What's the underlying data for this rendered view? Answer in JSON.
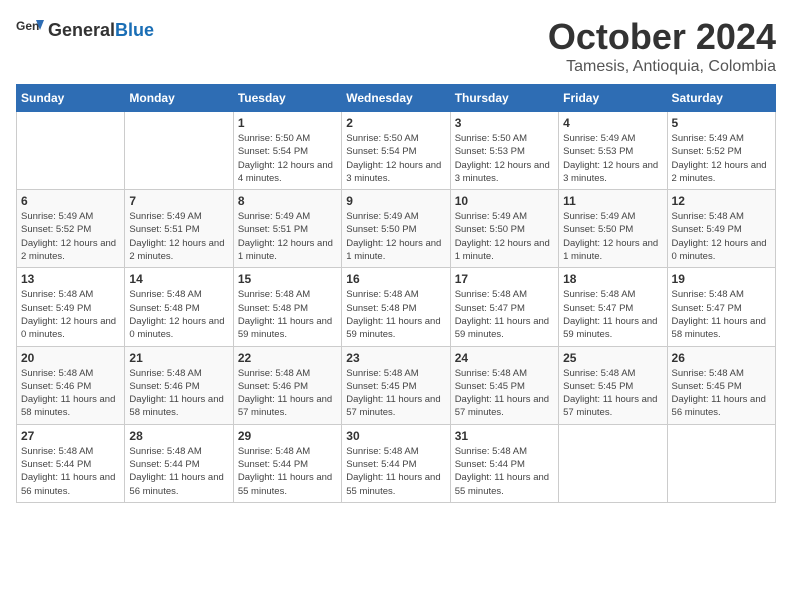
{
  "logo": {
    "general": "General",
    "blue": "Blue"
  },
  "title": {
    "month": "October 2024",
    "location": "Tamesis, Antioquia, Colombia"
  },
  "headers": [
    "Sunday",
    "Monday",
    "Tuesday",
    "Wednesday",
    "Thursday",
    "Friday",
    "Saturday"
  ],
  "weeks": [
    [
      {
        "day": "",
        "info": ""
      },
      {
        "day": "",
        "info": ""
      },
      {
        "day": "1",
        "info": "Sunrise: 5:50 AM\nSunset: 5:54 PM\nDaylight: 12 hours and 4 minutes."
      },
      {
        "day": "2",
        "info": "Sunrise: 5:50 AM\nSunset: 5:54 PM\nDaylight: 12 hours and 3 minutes."
      },
      {
        "day": "3",
        "info": "Sunrise: 5:50 AM\nSunset: 5:53 PM\nDaylight: 12 hours and 3 minutes."
      },
      {
        "day": "4",
        "info": "Sunrise: 5:49 AM\nSunset: 5:53 PM\nDaylight: 12 hours and 3 minutes."
      },
      {
        "day": "5",
        "info": "Sunrise: 5:49 AM\nSunset: 5:52 PM\nDaylight: 12 hours and 2 minutes."
      }
    ],
    [
      {
        "day": "6",
        "info": "Sunrise: 5:49 AM\nSunset: 5:52 PM\nDaylight: 12 hours and 2 minutes."
      },
      {
        "day": "7",
        "info": "Sunrise: 5:49 AM\nSunset: 5:51 PM\nDaylight: 12 hours and 2 minutes."
      },
      {
        "day": "8",
        "info": "Sunrise: 5:49 AM\nSunset: 5:51 PM\nDaylight: 12 hours and 1 minute."
      },
      {
        "day": "9",
        "info": "Sunrise: 5:49 AM\nSunset: 5:50 PM\nDaylight: 12 hours and 1 minute."
      },
      {
        "day": "10",
        "info": "Sunrise: 5:49 AM\nSunset: 5:50 PM\nDaylight: 12 hours and 1 minute."
      },
      {
        "day": "11",
        "info": "Sunrise: 5:49 AM\nSunset: 5:50 PM\nDaylight: 12 hours and 1 minute."
      },
      {
        "day": "12",
        "info": "Sunrise: 5:48 AM\nSunset: 5:49 PM\nDaylight: 12 hours and 0 minutes."
      }
    ],
    [
      {
        "day": "13",
        "info": "Sunrise: 5:48 AM\nSunset: 5:49 PM\nDaylight: 12 hours and 0 minutes."
      },
      {
        "day": "14",
        "info": "Sunrise: 5:48 AM\nSunset: 5:48 PM\nDaylight: 12 hours and 0 minutes."
      },
      {
        "day": "15",
        "info": "Sunrise: 5:48 AM\nSunset: 5:48 PM\nDaylight: 11 hours and 59 minutes."
      },
      {
        "day": "16",
        "info": "Sunrise: 5:48 AM\nSunset: 5:48 PM\nDaylight: 11 hours and 59 minutes."
      },
      {
        "day": "17",
        "info": "Sunrise: 5:48 AM\nSunset: 5:47 PM\nDaylight: 11 hours and 59 minutes."
      },
      {
        "day": "18",
        "info": "Sunrise: 5:48 AM\nSunset: 5:47 PM\nDaylight: 11 hours and 59 minutes."
      },
      {
        "day": "19",
        "info": "Sunrise: 5:48 AM\nSunset: 5:47 PM\nDaylight: 11 hours and 58 minutes."
      }
    ],
    [
      {
        "day": "20",
        "info": "Sunrise: 5:48 AM\nSunset: 5:46 PM\nDaylight: 11 hours and 58 minutes."
      },
      {
        "day": "21",
        "info": "Sunrise: 5:48 AM\nSunset: 5:46 PM\nDaylight: 11 hours and 58 minutes."
      },
      {
        "day": "22",
        "info": "Sunrise: 5:48 AM\nSunset: 5:46 PM\nDaylight: 11 hours and 57 minutes."
      },
      {
        "day": "23",
        "info": "Sunrise: 5:48 AM\nSunset: 5:45 PM\nDaylight: 11 hours and 57 minutes."
      },
      {
        "day": "24",
        "info": "Sunrise: 5:48 AM\nSunset: 5:45 PM\nDaylight: 11 hours and 57 minutes."
      },
      {
        "day": "25",
        "info": "Sunrise: 5:48 AM\nSunset: 5:45 PM\nDaylight: 11 hours and 57 minutes."
      },
      {
        "day": "26",
        "info": "Sunrise: 5:48 AM\nSunset: 5:45 PM\nDaylight: 11 hours and 56 minutes."
      }
    ],
    [
      {
        "day": "27",
        "info": "Sunrise: 5:48 AM\nSunset: 5:44 PM\nDaylight: 11 hours and 56 minutes."
      },
      {
        "day": "28",
        "info": "Sunrise: 5:48 AM\nSunset: 5:44 PM\nDaylight: 11 hours and 56 minutes."
      },
      {
        "day": "29",
        "info": "Sunrise: 5:48 AM\nSunset: 5:44 PM\nDaylight: 11 hours and 55 minutes."
      },
      {
        "day": "30",
        "info": "Sunrise: 5:48 AM\nSunset: 5:44 PM\nDaylight: 11 hours and 55 minutes."
      },
      {
        "day": "31",
        "info": "Sunrise: 5:48 AM\nSunset: 5:44 PM\nDaylight: 11 hours and 55 minutes."
      },
      {
        "day": "",
        "info": ""
      },
      {
        "day": "",
        "info": ""
      }
    ]
  ]
}
